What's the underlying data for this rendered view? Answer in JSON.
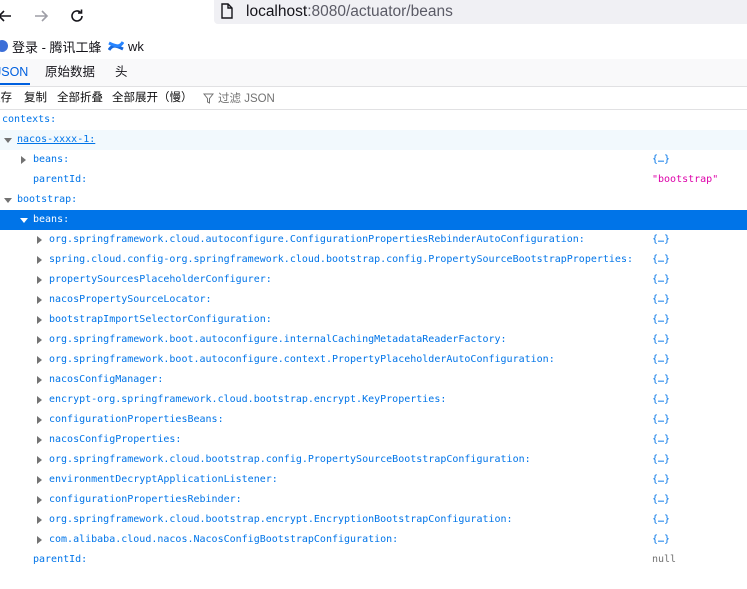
{
  "browser": {
    "url_host": "localhost",
    "url_rest": ":8080/actuator/beans",
    "bookmarks": [
      {
        "label": "登录 - 腾讯工蜂"
      },
      {
        "label": "wk"
      }
    ]
  },
  "viewer": {
    "tabs": [
      "JSON",
      "原始数据",
      "头"
    ],
    "toolbar": {
      "save": "保存",
      "copy": "复制",
      "collapse_all": "全部折叠",
      "expand_all": "全部展开（慢）",
      "filter_placeholder": "过滤 JSON"
    }
  },
  "tree": {
    "contexts_key": "contexts:",
    "ctx1": {
      "key": "nacos-xxxx-1:",
      "beans_key": "beans:",
      "beans_val": "{…}",
      "parentId_key": "parentId:",
      "parentId_val": "\"bootstrap\""
    },
    "ctx2": {
      "key": "bootstrap:",
      "beans_key": "beans:",
      "beans": [
        {
          "key": "org.springframework.cloud.autoconfigure.ConfigurationPropertiesRebinderAutoConfiguration:",
          "val": "{…}"
        },
        {
          "key": "spring.cloud.config-org.springframework.cloud.bootstrap.config.PropertySourceBootstrapProperties:",
          "val": "{…}"
        },
        {
          "key": "propertySourcesPlaceholderConfigurer:",
          "val": "{…}"
        },
        {
          "key": "nacosPropertySourceLocator:",
          "val": "{…}"
        },
        {
          "key": "bootstrapImportSelectorConfiguration:",
          "val": "{…}"
        },
        {
          "key": "org.springframework.boot.autoconfigure.internalCachingMetadataReaderFactory:",
          "val": "{…}"
        },
        {
          "key": "org.springframework.boot.autoconfigure.context.PropertyPlaceholderAutoConfiguration:",
          "val": "{…}"
        },
        {
          "key": "nacosConfigManager:",
          "val": "{…}"
        },
        {
          "key": "encrypt-org.springframework.cloud.bootstrap.encrypt.KeyProperties:",
          "val": "{…}"
        },
        {
          "key": "configurationPropertiesBeans:",
          "val": "{…}"
        },
        {
          "key": "nacosConfigProperties:",
          "val": "{…}"
        },
        {
          "key": "org.springframework.cloud.bootstrap.config.PropertySourceBootstrapConfiguration:",
          "val": "{…}"
        },
        {
          "key": "environmentDecryptApplicationListener:",
          "val": "{…}"
        },
        {
          "key": "configurationPropertiesRebinder:",
          "val": "{…}"
        },
        {
          "key": "org.springframework.cloud.bootstrap.encrypt.EncryptionBootstrapConfiguration:",
          "val": "{…}"
        },
        {
          "key": "com.alibaba.cloud.nacos.NacosConfigBootstrapConfiguration:",
          "val": "{…}"
        }
      ],
      "parentId_key": "parentId:",
      "parentId_val": "null"
    }
  }
}
